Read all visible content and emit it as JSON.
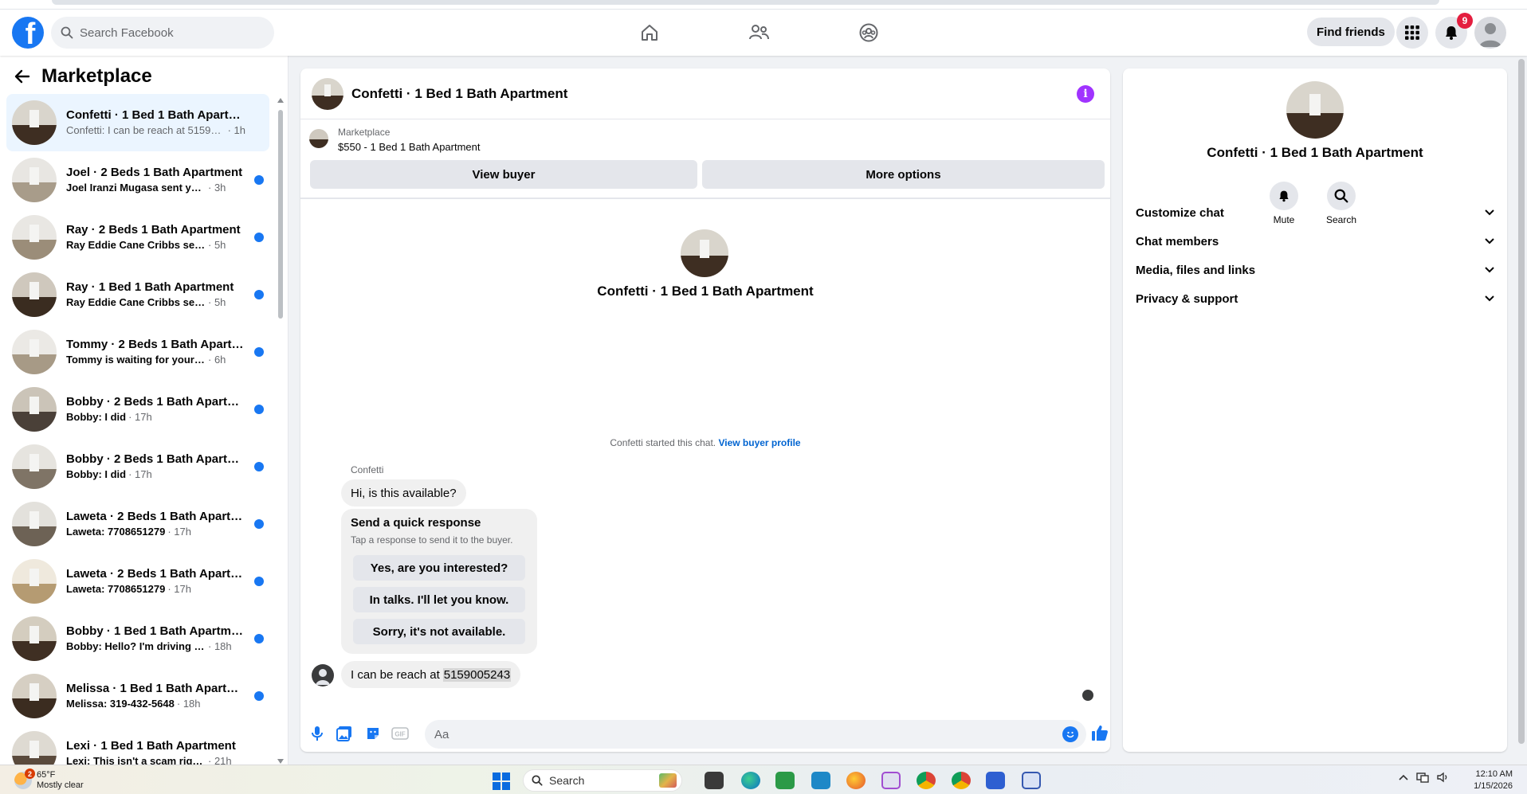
{
  "topnav": {
    "logo": "facebook-logo",
    "search_placeholder": "Search Facebook",
    "find_friends_label": "Find friends",
    "notification_count": "9"
  },
  "sidebar": {
    "title": "Marketplace",
    "conversations": [
      {
        "title": "Confetti · 1 Bed 1 Bath Apartment",
        "snippet": "Confetti: I can be reach at 5159005...",
        "time": "· 1h",
        "unread": false,
        "active": true
      },
      {
        "title": "Joel · 2 Beds 1 Bath Apartment",
        "snippet": "Joel Iranzi Mugasa sent you a m...",
        "time": "· 3h",
        "unread": true,
        "active": false
      },
      {
        "title": "Ray · 2 Beds 1 Bath Apartment",
        "snippet": "Ray Eddie Cane Cribbs sent you ...",
        "time": "· 5h",
        "unread": true,
        "active": false
      },
      {
        "title": "Ray · 1 Bed 1 Bath Apartment",
        "snippet": "Ray Eddie Cane Cribbs sent you ...",
        "time": "· 5h",
        "unread": true,
        "active": false
      },
      {
        "title": "Tommy · 2 Beds 1 Bath Apartm...",
        "snippet": "Tommy is waiting for your resp...",
        "time": "· 6h",
        "unread": true,
        "active": false
      },
      {
        "title": "Bobby · 2 Beds 1 Bath Apartm...",
        "snippet": "Bobby: I did",
        "time": "· 17h",
        "unread": true,
        "active": false
      },
      {
        "title": "Bobby · 2 Beds 1 Bath Apartm...",
        "snippet": "Bobby: I did",
        "time": "· 17h",
        "unread": true,
        "active": false
      },
      {
        "title": "Laweta · 2 Beds 1 Bath Apartm...",
        "snippet": "Laweta: 7708651279",
        "time": "· 17h",
        "unread": true,
        "active": false
      },
      {
        "title": "Laweta · 2 Beds 1 Bath Apartm...",
        "snippet": "Laweta: 7708651279",
        "time": "· 17h",
        "unread": true,
        "active": false
      },
      {
        "title": "Bobby · 1 Bed 1 Bath Apartment",
        "snippet": "Bobby: Hello? I'm driving a veh...",
        "time": "· 18h",
        "unread": true,
        "active": false
      },
      {
        "title": "Melissa · 1 Bed 1 Bath Apartme...",
        "snippet": "Melissa: 319-432-5648",
        "time": "· 18h",
        "unread": true,
        "active": false
      },
      {
        "title": "Lexi · 1 Bed 1 Bath Apartment",
        "snippet": "Lexi: This isn't a scam right ?",
        "time": "· 21h",
        "unread": false,
        "active": false
      }
    ]
  },
  "chat": {
    "title": "Confetti · 1 Bed 1 Bath Apartment",
    "listing_source": "Marketplace",
    "listing_name": "$550 - 1 Bed 1 Bath Apartment",
    "view_buyer_label": "View buyer",
    "more_options_label": "More options",
    "intro_title": "Confetti · 1 Bed 1 Bath Apartment",
    "started_text": "Confetti started this chat.",
    "view_buyer_profile_label": "View buyer profile",
    "sender_name": "Confetti",
    "first_message": "Hi, is this available?",
    "quick_response_title": "Send a quick response",
    "quick_response_subtitle": "Tap a response to send it to the buyer.",
    "quick_responses": [
      "Yes, are you interested?",
      "In talks. I'll let you know.",
      "Sorry, it's not available."
    ],
    "reply_text": "I can be reach at",
    "reply_highlight": "5159005243",
    "input_placeholder": "Aa"
  },
  "info_panel": {
    "title": "Confetti · 1 Bed 1 Bath Apartment",
    "mute_label": "Mute",
    "search_label": "Search",
    "sections": [
      "Customize chat",
      "Chat members",
      "Media, files and links",
      "Privacy & support"
    ]
  },
  "taskbar": {
    "weather_badge": "2",
    "temperature": "65°F",
    "condition": "Mostly clear",
    "search_label": "Search",
    "time": "12:10 AM",
    "date": "1/15/2026"
  },
  "colors": {
    "brand": "#1877f2",
    "unread": "#1877f2",
    "info_accent": "#a033ff",
    "badge": "#e41e3f"
  }
}
